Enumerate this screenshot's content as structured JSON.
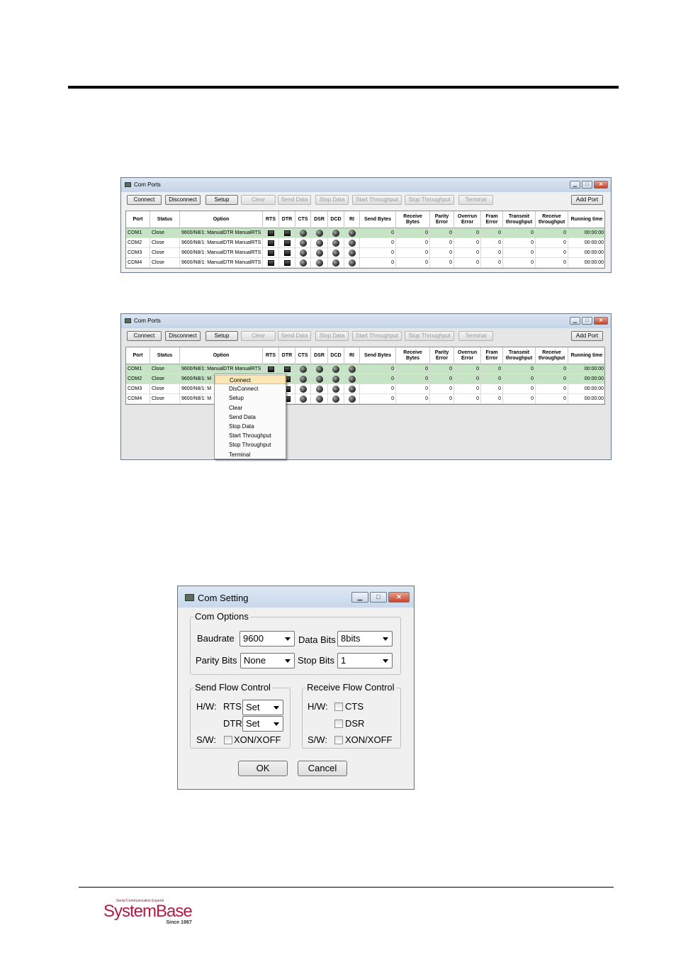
{
  "com_ports": {
    "title": "Com Ports",
    "toolbar": [
      {
        "label": "Connect",
        "enabled": true
      },
      {
        "label": "Disconnect",
        "enabled": true
      },
      {
        "label": "Setup",
        "enabled": true
      },
      {
        "label": "Clear",
        "enabled": false
      },
      {
        "label": "Send Data",
        "enabled": false
      },
      {
        "label": "Stop Data",
        "enabled": false
      },
      {
        "label": "Start Throughput",
        "enabled": false
      },
      {
        "label": "Stop Throughput",
        "enabled": false
      },
      {
        "label": "Terminal",
        "enabled": false
      }
    ],
    "add_port": "Add Port",
    "columns": [
      "Port",
      "Status",
      "Option",
      "RTS",
      "DTR",
      "CTS",
      "DSR",
      "DCD",
      "RI",
      "Send Bytes",
      "Receive Bytes",
      "Parity Error",
      "Overrun Error",
      "Fram Error",
      "Transmit throughput",
      "Receive throughput",
      "Running time"
    ],
    "rows": [
      {
        "port": "COM1",
        "status": "Close",
        "option": "9600/N8/1: ManualDTR ManualRTS",
        "send": "0",
        "recv": "0",
        "parity": "0",
        "overrun": "0",
        "fram": "0",
        "tx": "0",
        "rx": "0",
        "time": "00:00:00"
      },
      {
        "port": "COM2",
        "status": "Close",
        "option": "9600/N8/1: ManualDTR ManualRTS",
        "send": "0",
        "recv": "0",
        "parity": "0",
        "overrun": "0",
        "fram": "0",
        "tx": "0",
        "rx": "0",
        "time": "00:00:00"
      },
      {
        "port": "COM3",
        "status": "Close",
        "option": "9600/N8/1: ManualDTR ManualRTS",
        "send": "0",
        "recv": "0",
        "parity": "0",
        "overrun": "0",
        "fram": "0",
        "tx": "0",
        "rx": "0",
        "time": "00:00:00"
      },
      {
        "port": "COM4",
        "status": "Close",
        "option": "9600/N8/1: ManualDTR ManualRTS",
        "send": "0",
        "recv": "0",
        "parity": "0",
        "overrun": "0",
        "fram": "0",
        "tx": "0",
        "rx": "0",
        "time": "00:00:00"
      }
    ],
    "truncated_option": "9600/N8/1: M",
    "context_menu": [
      "Connect",
      "DisConnect",
      "Setup",
      "Clear",
      "Send Data",
      "Stop Data",
      "Start Throughput",
      "Stop Throughput",
      "Terminal"
    ]
  },
  "com_setting": {
    "title": "Com Setting",
    "options_group": "Com Options",
    "baudrate_label": "Baudrate",
    "baudrate_value": "9600",
    "databits_label": "Data Bits",
    "databits_value": "8bits",
    "parity_label": "Parity Bits",
    "parity_value": "None",
    "stopbits_label": "Stop Bits",
    "stopbits_value": "1",
    "send_flow_group": "Send Flow Control",
    "hw_label": "H/W:",
    "rts_label": "RTS",
    "rts_value": "Set",
    "dtr_label": "DTR",
    "dtr_value": "Set",
    "sw_label": "S/W:",
    "xon_label": "XON/XOFF",
    "recv_flow_group": "Receive Flow Control",
    "cts_label": "CTS",
    "dsr_label": "DSR",
    "ok": "OK",
    "cancel": "Cancel"
  },
  "logo": {
    "tagline": "Serial Communication Experts",
    "name": "SystemBase",
    "since": "Since 1987"
  },
  "window_buttons": {
    "min": "▁",
    "max": "□",
    "close": "✕"
  },
  "colors": {
    "selected_row": "#c6e3c6",
    "menu_highlight": "#fbe7b5",
    "brand": "#b11c44"
  }
}
